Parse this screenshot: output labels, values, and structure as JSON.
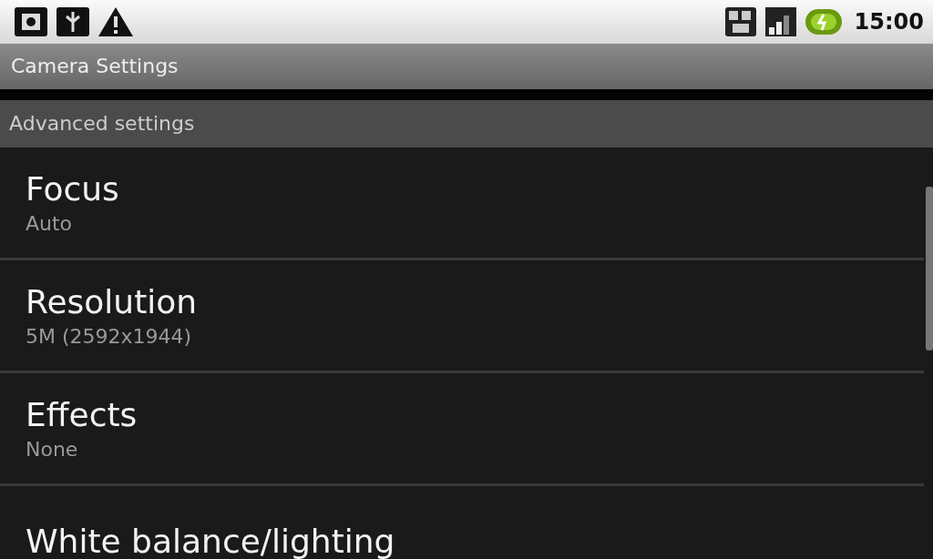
{
  "status_bar": {
    "time": "15:00"
  },
  "title_bar": {
    "title": "Camera Settings"
  },
  "section": {
    "title": "Advanced settings"
  },
  "preferences": [
    {
      "title": "Focus",
      "summary": "Auto"
    },
    {
      "title": "Resolution",
      "summary": "5M (2592x1944)"
    },
    {
      "title": "Effects",
      "summary": "None"
    },
    {
      "title": "White balance/lighting"
    }
  ]
}
